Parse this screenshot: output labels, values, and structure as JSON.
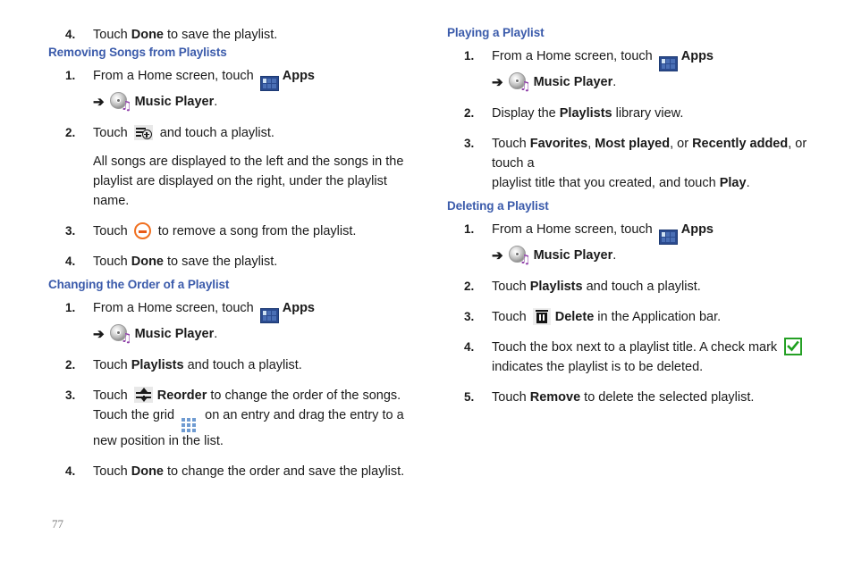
{
  "page": {
    "number": "77"
  },
  "icons": {
    "apps": "apps-grid-icon",
    "music_player": "music-player-disc-icon",
    "add_to_playlist": "add-to-playlist-icon",
    "remove": "remove-minus-icon",
    "reorder": "reorder-icon",
    "drag_grid": "drag-grid-handle-icon",
    "delete": "trash-delete-icon",
    "checkmark": "green-checkmark-icon",
    "arrow": "➔"
  },
  "colors": {
    "heading": "#3b5bab",
    "apps_icon": "#2b4b8f",
    "remove_icon": "#e85a18",
    "check_icon": "#25a025",
    "music_note": "#8e3fa8",
    "page_number": "#7d7d7d"
  },
  "left_column": {
    "intro_step": {
      "num": "4.",
      "pre": "Touch ",
      "bold": "Done",
      "post": " to save the playlist."
    },
    "sections": [
      {
        "heading": "Removing Songs from Playlists",
        "steps": [
          {
            "num": "1.",
            "line1_pre": "From a Home screen, touch ",
            "line1_bold": "Apps",
            "line2_bold": "Music Player",
            "line2_post": "."
          },
          {
            "num": "2.",
            "pre": "Touch ",
            "post": " and touch a playlist.",
            "para_line1": "All songs are displayed to the left and the songs in the",
            "para_line2": "playlist are displayed on the right, under the playlist name."
          },
          {
            "num": "3.",
            "pre": "Touch ",
            "post": " to remove a song from the playlist."
          },
          {
            "num": "4.",
            "pre": "Touch ",
            "bold": "Done",
            "post": " to save the playlist."
          }
        ]
      },
      {
        "heading": "Changing the Order of a Playlist",
        "steps": [
          {
            "num": "1.",
            "line1_pre": "From a Home screen, touch ",
            "line1_bold": "Apps",
            "line2_bold": "Music Player",
            "line2_post": "."
          },
          {
            "num": "2.",
            "pre": "Touch ",
            "bold": "Playlists",
            "post": " and touch a playlist."
          },
          {
            "num": "3.",
            "pre": "Touch ",
            "bold": "Reorder",
            "post": " to change the order of the songs.",
            "line2_pre": "Touch the grid ",
            "line2_post": " on an entry and drag the entry to a",
            "line3": "new position in the list."
          },
          {
            "num": "4.",
            "pre": "Touch ",
            "bold": "Done",
            "post": " to change the order and save the playlist."
          }
        ]
      }
    ]
  },
  "right_column": {
    "sections": [
      {
        "heading": "Playing a Playlist",
        "steps": [
          {
            "num": "1.",
            "line1_pre": "From a Home screen, touch ",
            "line1_bold": "Apps",
            "line2_bold": "Music Player",
            "line2_post": "."
          },
          {
            "num": "2.",
            "pre": "Display the ",
            "bold": "Playlists",
            "post": " library view."
          },
          {
            "num": "3.",
            "seg1": "Touch ",
            "bold1": "Favorites",
            "seg2": ", ",
            "bold2": "Most played",
            "seg3": ", or ",
            "bold3": "Recently added",
            "seg4": ", or touch a",
            "line2_pre": "playlist title that you created, and touch ",
            "line2_bold": "Play",
            "line2_post": "."
          }
        ]
      },
      {
        "heading": "Deleting a Playlist",
        "steps": [
          {
            "num": "1.",
            "line1_pre": "From a Home screen, touch ",
            "line1_bold": "Apps",
            "line2_bold": "Music Player",
            "line2_post": "."
          },
          {
            "num": "2.",
            "pre": "Touch ",
            "bold": "Playlists",
            "post": " and touch a playlist."
          },
          {
            "num": "3.",
            "pre": "Touch ",
            "bold": "Delete",
            "post": " in the Application bar."
          },
          {
            "num": "4.",
            "pre": "Touch the box next to a playlist title. A check mark ",
            "line2": "indicates the playlist is to be deleted."
          },
          {
            "num": "5.",
            "pre": "Touch ",
            "bold": "Remove",
            "post": " to delete the selected playlist."
          }
        ]
      }
    ]
  }
}
